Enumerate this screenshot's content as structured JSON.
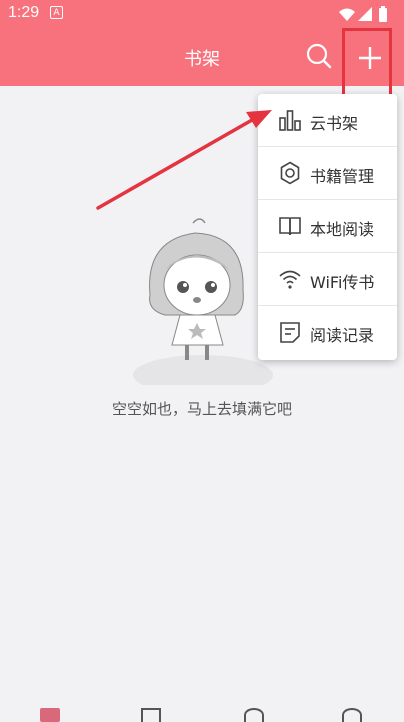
{
  "status": {
    "time": "1:29",
    "notification_letter": "A",
    "wifi_icon": "wifi-icon",
    "signal_icon": "signal-icon",
    "battery_icon": "battery-icon"
  },
  "toolbar": {
    "title": "书架",
    "search_icon": "search-icon",
    "add_icon": "plus-icon"
  },
  "menu": {
    "items": [
      {
        "label": "云书架",
        "icon": "bar-chart-icon"
      },
      {
        "label": "书籍管理",
        "icon": "gear-icon"
      },
      {
        "label": "本地阅读",
        "icon": "book-icon"
      },
      {
        "label": "WiFi传书",
        "icon": "wifi-icon"
      },
      {
        "label": "阅读记录",
        "icon": "document-icon"
      }
    ]
  },
  "empty_state": {
    "text": "空空如也，马上去填满它吧"
  },
  "colors": {
    "accent": "#f8727e",
    "annotation": "#e4343f"
  },
  "bottom_tabs": [
    "bookshelf-tab-icon",
    "discover-tab-icon",
    "compass-tab-icon",
    "profile-tab-icon"
  ]
}
